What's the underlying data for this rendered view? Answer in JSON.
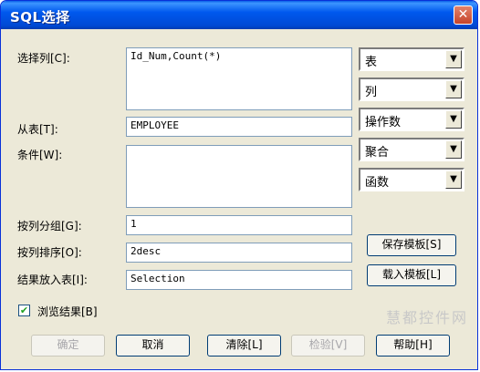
{
  "window": {
    "title": "SQL选择",
    "close_symbol": "✕"
  },
  "labels": {
    "select_columns": "选择列[C]:",
    "from_table": "从表[T]:",
    "condition": "条件[W]:",
    "group_by": "按列分组[G]:",
    "order_by": "按列排序[O]:",
    "into_table": "结果放入表[I]:",
    "browse_results": "浏览结果[B]"
  },
  "fields": {
    "select_columns": "Id_Num,Count(*)",
    "from_table": "EMPLOYEE",
    "condition": "",
    "group_by": "1",
    "order_by": "2desc",
    "into_table": "Selection"
  },
  "combos": {
    "table": "表",
    "column": "列",
    "operator": "操作数",
    "aggregate": "聚合",
    "function": "函数",
    "arrow_symbol": "▼"
  },
  "browse_checked": true,
  "buttons": {
    "save_template": "保存模板[S]",
    "load_template": "载入模板[L]",
    "ok": "确定",
    "cancel": "取消",
    "clear": "清除[L]",
    "verify": "检验[V]",
    "help": "帮助[H]"
  },
  "watermark": "慧都控件网"
}
